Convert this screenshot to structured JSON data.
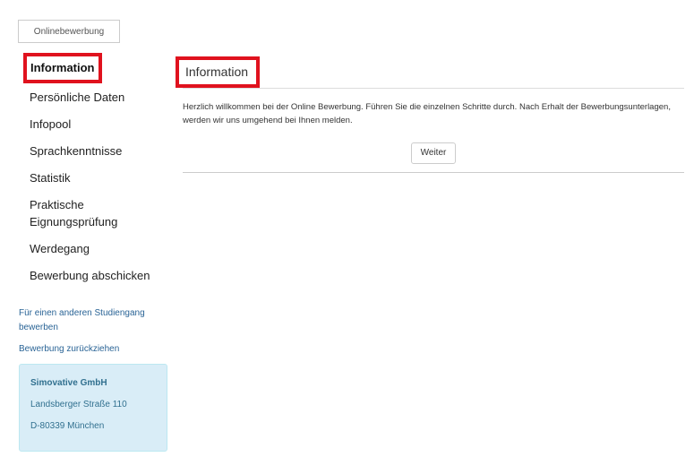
{
  "tab": {
    "label": "Onlinebewerbung"
  },
  "sidebar": {
    "active_item": "Information",
    "items": [
      {
        "label": "Persönliche Daten"
      },
      {
        "label": "Infopool"
      },
      {
        "label": "Sprachkenntnisse"
      },
      {
        "label": "Statistik"
      },
      {
        "label": "Praktische\nEignungsprüfung"
      },
      {
        "label": "Werdegang"
      },
      {
        "label": "Bewerbung abschicken"
      }
    ],
    "links": [
      {
        "label": "Für einen anderen Studiengang bewerben"
      },
      {
        "label": "Bewerbung zurückziehen"
      }
    ]
  },
  "address": {
    "company": "Simovative GmbH",
    "street": "Landsberger Straße 110",
    "city": "D-80339 München"
  },
  "main": {
    "heading": "Information",
    "intro": "Herzlich willkommen bei der Online Bewerbung. Führen Sie die einzelnen Schritte durch. Nach Erhalt der Bewerbungsunterlagen, werden wir uns umgehend bei Ihnen melden.",
    "next_button": "Weiter"
  },
  "colors": {
    "highlight": "#e0121e",
    "link": "#2a6496",
    "info_box_bg": "#d9edf7",
    "info_box_text": "#31708f"
  }
}
